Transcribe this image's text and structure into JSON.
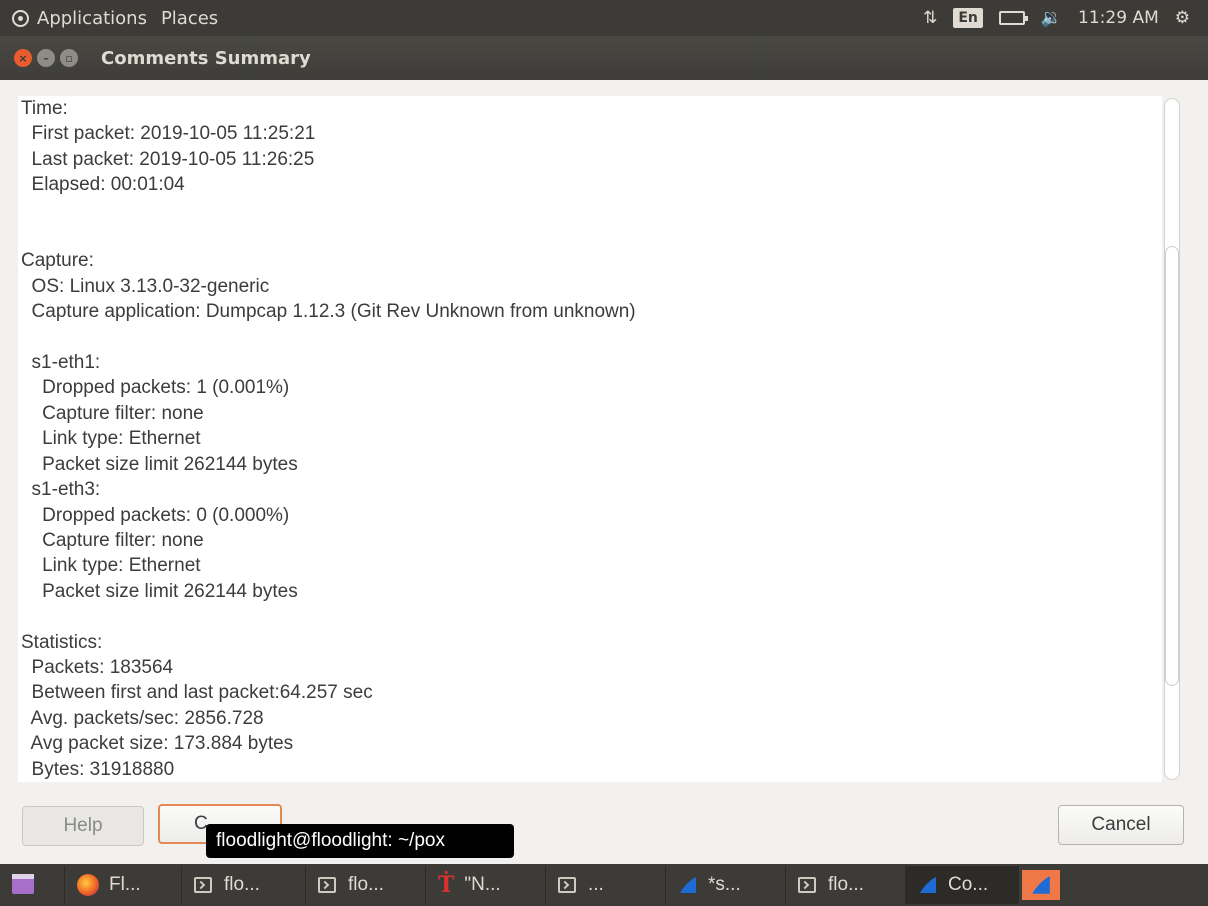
{
  "top_panel": {
    "menus": [
      "Applications",
      "Places"
    ],
    "keyboard_layout": "En",
    "clock": "11:29 AM",
    "icons": [
      "network-icon",
      "battery-icon",
      "volume-icon",
      "settings-gear-icon"
    ]
  },
  "window": {
    "title": "Comments Summary"
  },
  "summary_text": "Time:\n  First packet: 2019-10-05 11:25:21\n  Last packet: 2019-10-05 11:26:25\n  Elapsed: 00:01:04\n\n\nCapture:\n  OS: Linux 3.13.0-32-generic\n  Capture application: Dumpcap 1.12.3 (Git Rev Unknown from unknown)\n\n  s1-eth1:\n    Dropped packets: 1 (0.001%)\n    Capture filter: none\n    Link type: Ethernet\n    Packet size limit 262144 bytes\n  s1-eth3:\n    Dropped packets: 0 (0.000%)\n    Capture filter: none\n    Link type: Ethernet\n    Packet size limit 262144 bytes\n\nStatistics:\n  Packets: 183564\n  Between first and last packet:64.257 sec\n  Avg. packets/sec: 2856.728\n  Avg packet size: 173.884 bytes\n  Bytes: 31918880",
  "buttons": {
    "help": "Help",
    "close": "C",
    "cancel": "Cancel"
  },
  "tooltip": "floodlight@floodlight: ~/pox",
  "taskbar": {
    "items": [
      {
        "label": "Fl...",
        "icon": "firefox-icon"
      },
      {
        "label": "flo...",
        "icon": "terminal-icon"
      },
      {
        "label": "flo...",
        "icon": "terminal-icon"
      },
      {
        "label": "\"N...",
        "icon": "tk-app-icon"
      },
      {
        "label": "...",
        "icon": "terminal-icon"
      },
      {
        "label": "*s...",
        "icon": "wireshark-icon"
      },
      {
        "label": "flo...",
        "icon": "terminal-icon"
      },
      {
        "label": "Co...",
        "icon": "wireshark-icon"
      }
    ]
  },
  "colors": {
    "panel_bg": "#3c3b37",
    "close_accent": "#e95c2f",
    "focus_orange": "#e58856",
    "wireshark_blue": "#1f6bd6"
  }
}
